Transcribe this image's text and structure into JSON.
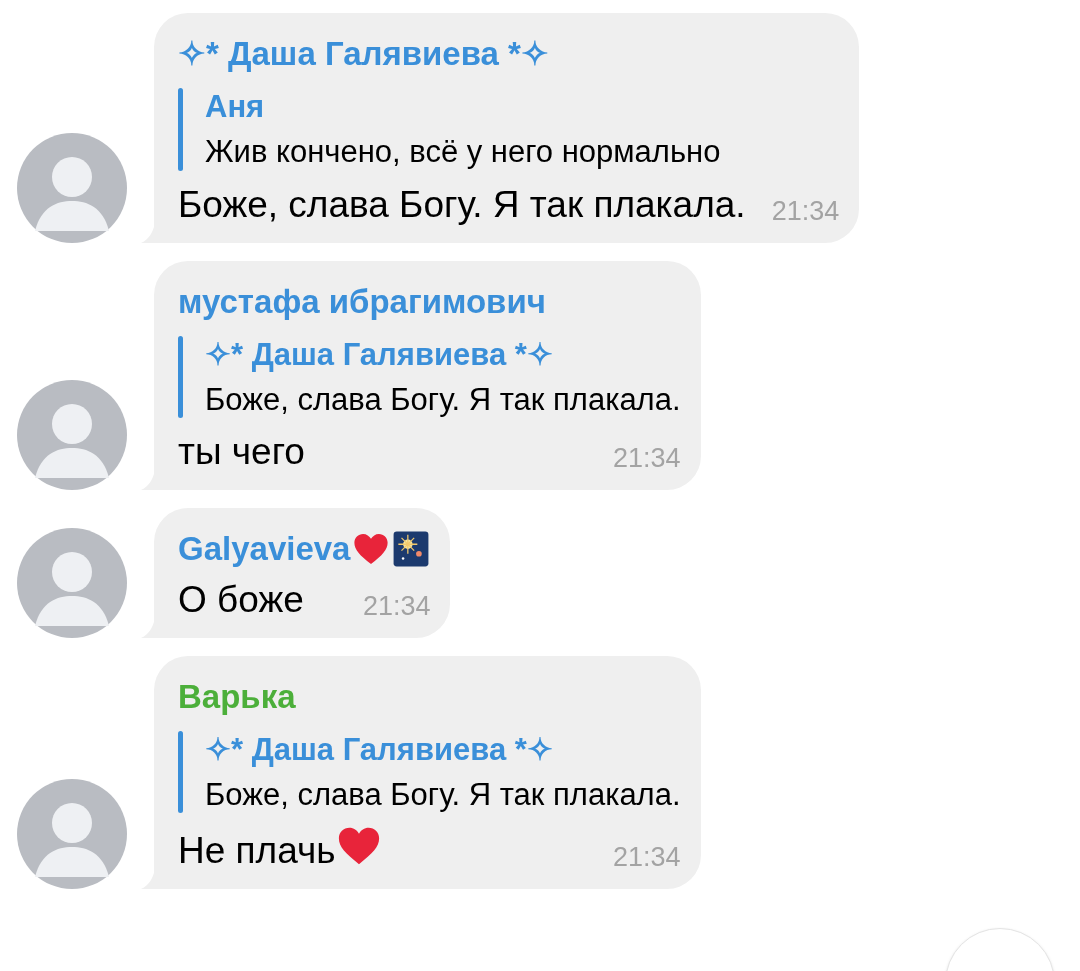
{
  "messages": [
    {
      "sender": "✧* Даша Галявиева *✧",
      "color": "#3a8fd9",
      "reply": {
        "sender": "Аня",
        "text": "Жив кончено, всё у него нормально"
      },
      "text": "Боже, слава Богу. Я так плакала.",
      "time": "21:34"
    },
    {
      "sender": "мустафа ибрагимович",
      "color": "#3a8fd9",
      "reply": {
        "sender": "✧* Даша Галявиева *✧",
        "text": "Боже, слава Богу. Я так плакала."
      },
      "text": "ты чего",
      "time": "21:34"
    },
    {
      "sender": "Galyavieva",
      "color": "#3a8fd9",
      "sender_icons": [
        {
          "kind": "heart"
        },
        {
          "kind": "fireworks"
        }
      ],
      "text": "О боже",
      "time": "21:34"
    },
    {
      "sender": "Варька",
      "color": "#4caf3a",
      "reply": {
        "sender": "✧* Даша Галявиева *✧",
        "text": "Боже, слава Богу. Я так плакала."
      },
      "text": "Не плачь",
      "text_icons": [
        {
          "kind": "heart"
        }
      ],
      "time": "21:34"
    }
  ]
}
